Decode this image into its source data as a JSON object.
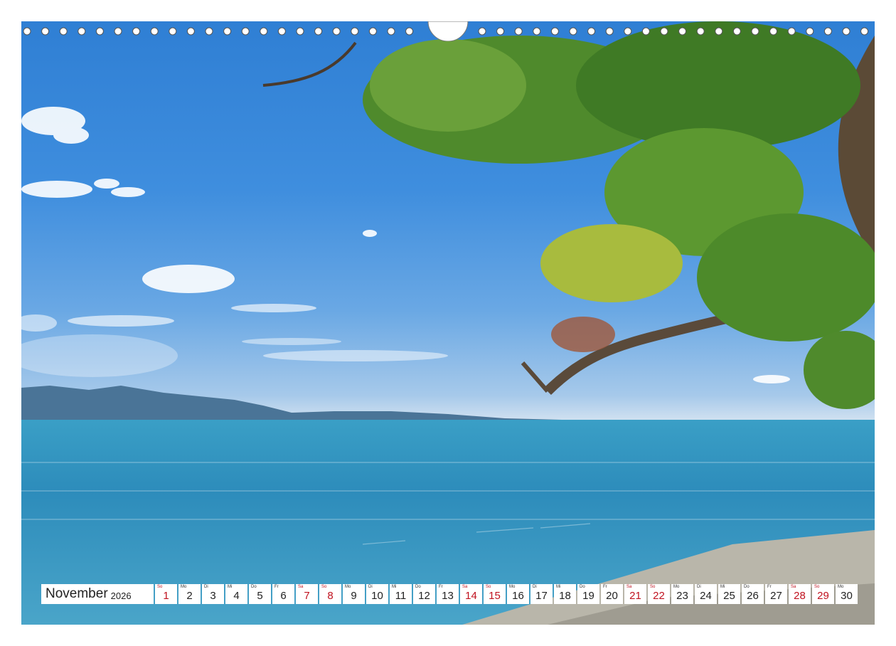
{
  "calendar": {
    "month": "November",
    "year": "2026",
    "weekend_color": "#c0121f",
    "days": [
      {
        "wd": "So",
        "n": "1",
        "red": true
      },
      {
        "wd": "Mo",
        "n": "2",
        "red": false
      },
      {
        "wd": "Di",
        "n": "3",
        "red": false
      },
      {
        "wd": "Mi",
        "n": "4",
        "red": false
      },
      {
        "wd": "Do",
        "n": "5",
        "red": false
      },
      {
        "wd": "Fr",
        "n": "6",
        "red": false
      },
      {
        "wd": "Sa",
        "n": "7",
        "red": true
      },
      {
        "wd": "So",
        "n": "8",
        "red": true
      },
      {
        "wd": "Mo",
        "n": "9",
        "red": false
      },
      {
        "wd": "Di",
        "n": "10",
        "red": false
      },
      {
        "wd": "Mi",
        "n": "11",
        "red": false
      },
      {
        "wd": "Do",
        "n": "12",
        "red": false
      },
      {
        "wd": "Fr",
        "n": "13",
        "red": false
      },
      {
        "wd": "Sa",
        "n": "14",
        "red": true
      },
      {
        "wd": "So",
        "n": "15",
        "red": true
      },
      {
        "wd": "Mo",
        "n": "16",
        "red": false
      },
      {
        "wd": "Di",
        "n": "17",
        "red": false
      },
      {
        "wd": "Mi",
        "n": "18",
        "red": false
      },
      {
        "wd": "Do",
        "n": "19",
        "red": false
      },
      {
        "wd": "Fr",
        "n": "20",
        "red": false
      },
      {
        "wd": "Sa",
        "n": "21",
        "red": true
      },
      {
        "wd": "So",
        "n": "22",
        "red": true
      },
      {
        "wd": "Mo",
        "n": "23",
        "red": false
      },
      {
        "wd": "Di",
        "n": "24",
        "red": false
      },
      {
        "wd": "Mi",
        "n": "25",
        "red": false
      },
      {
        "wd": "Do",
        "n": "26",
        "red": false
      },
      {
        "wd": "Fr",
        "n": "27",
        "red": false
      },
      {
        "wd": "Sa",
        "n": "28",
        "red": true
      },
      {
        "wd": "So",
        "n": "29",
        "red": true
      },
      {
        "wd": "Mo",
        "n": "30",
        "red": false
      }
    ]
  }
}
